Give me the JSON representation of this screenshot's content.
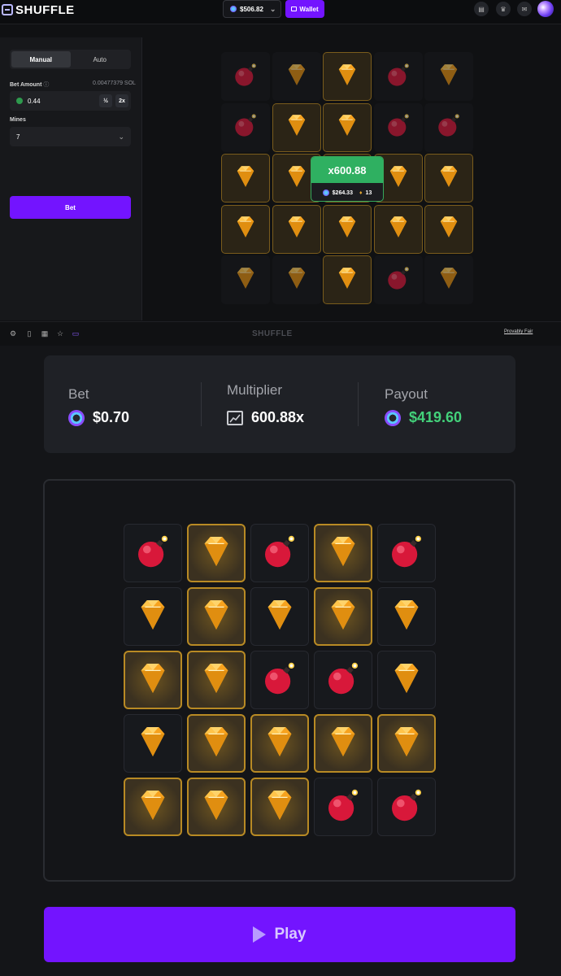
{
  "header": {
    "logo_text": "SHUFFLE",
    "balance": "$506.82",
    "wallet_label": "Wallet"
  },
  "controls": {
    "tabs": [
      "Manual",
      "Auto"
    ],
    "bet_amount_label": "Bet Amount",
    "bet_amount_sol": "0.00477379 SOL",
    "bet_amount_value": "0.44",
    "half_label": "½",
    "double_label": "2x",
    "mines_label": "Mines",
    "mines_value": "7",
    "bet_button": "Bet"
  },
  "top_grid": [
    [
      "bomb",
      "gem",
      "gem-hl",
      "bomb",
      "gem"
    ],
    [
      "bomb",
      "gem-hl",
      "gem-hl",
      "bomb",
      "bomb"
    ],
    [
      "gem-hl",
      "gem-hl",
      "gem-hl",
      "gem-hl",
      "gem-hl"
    ],
    [
      "gem-hl",
      "gem-hl",
      "gem-hl",
      "gem-hl",
      "gem-hl"
    ],
    [
      "gem",
      "gem",
      "gem-hl",
      "bomb",
      "gem"
    ]
  ],
  "win_popup": {
    "multiplier": "x600.88",
    "amount": "$264.33",
    "gems": "13"
  },
  "footer": {
    "logo_text": "SHUFFLE",
    "provably_fair": "Provably Fair"
  },
  "stats": {
    "bet_label": "Bet",
    "bet_value": "$0.70",
    "multiplier_label": "Multiplier",
    "multiplier_value": "600.88x",
    "payout_label": "Payout",
    "payout_value": "$419.60"
  },
  "bottom_grid": [
    [
      "bomb",
      "gem-hl",
      "bomb",
      "gem-hl",
      "bomb"
    ],
    [
      "gem",
      "gem-hl",
      "gem",
      "gem-hl",
      "gem"
    ],
    [
      "gem-hl",
      "gem-hl",
      "bomb",
      "bomb",
      "gem"
    ],
    [
      "gem",
      "gem-hl",
      "gem-hl",
      "gem-hl",
      "gem-hl"
    ],
    [
      "gem-hl",
      "gem-hl",
      "gem-hl",
      "bomb",
      "bomb"
    ]
  ],
  "play_button": "Play",
  "colors": {
    "accent": "#7314ff",
    "win_green": "#2fb061",
    "payout_green": "#43d17a",
    "gold_border": "#b88a24"
  }
}
